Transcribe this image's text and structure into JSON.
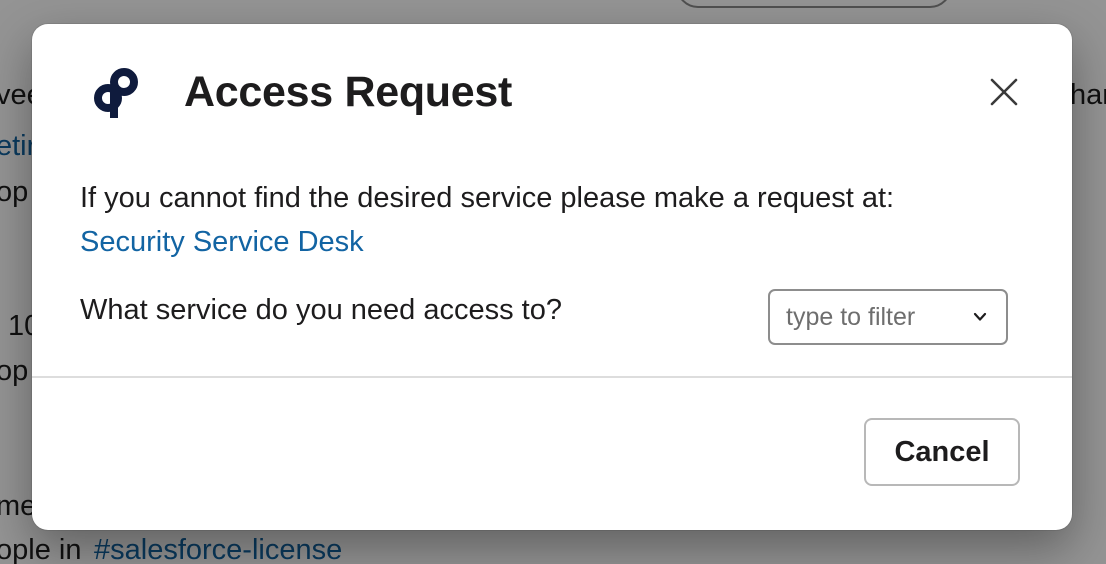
{
  "background": {
    "fragments": [
      "vee",
      "etir",
      "op",
      "10",
      "op",
      "me",
      "ople in",
      "har"
    ],
    "channel_link": "#salesforce-license"
  },
  "modal": {
    "title": "Access Request",
    "logo_icon": "app-logo-icon",
    "close_icon": "close-icon",
    "body_text": "If you cannot find the desired service please make a request at:",
    "desk_link": "Security Service Desk",
    "service_question": "What service do you need access to?",
    "select": {
      "placeholder": "type to filter",
      "icon": "chevron-down-icon"
    },
    "cancel_label": "Cancel"
  },
  "colors": {
    "link": "#1264a3",
    "text": "#1d1c1d",
    "logo": "#0f1b3d",
    "overlay": "rgba(0,0,0,0.42)"
  }
}
